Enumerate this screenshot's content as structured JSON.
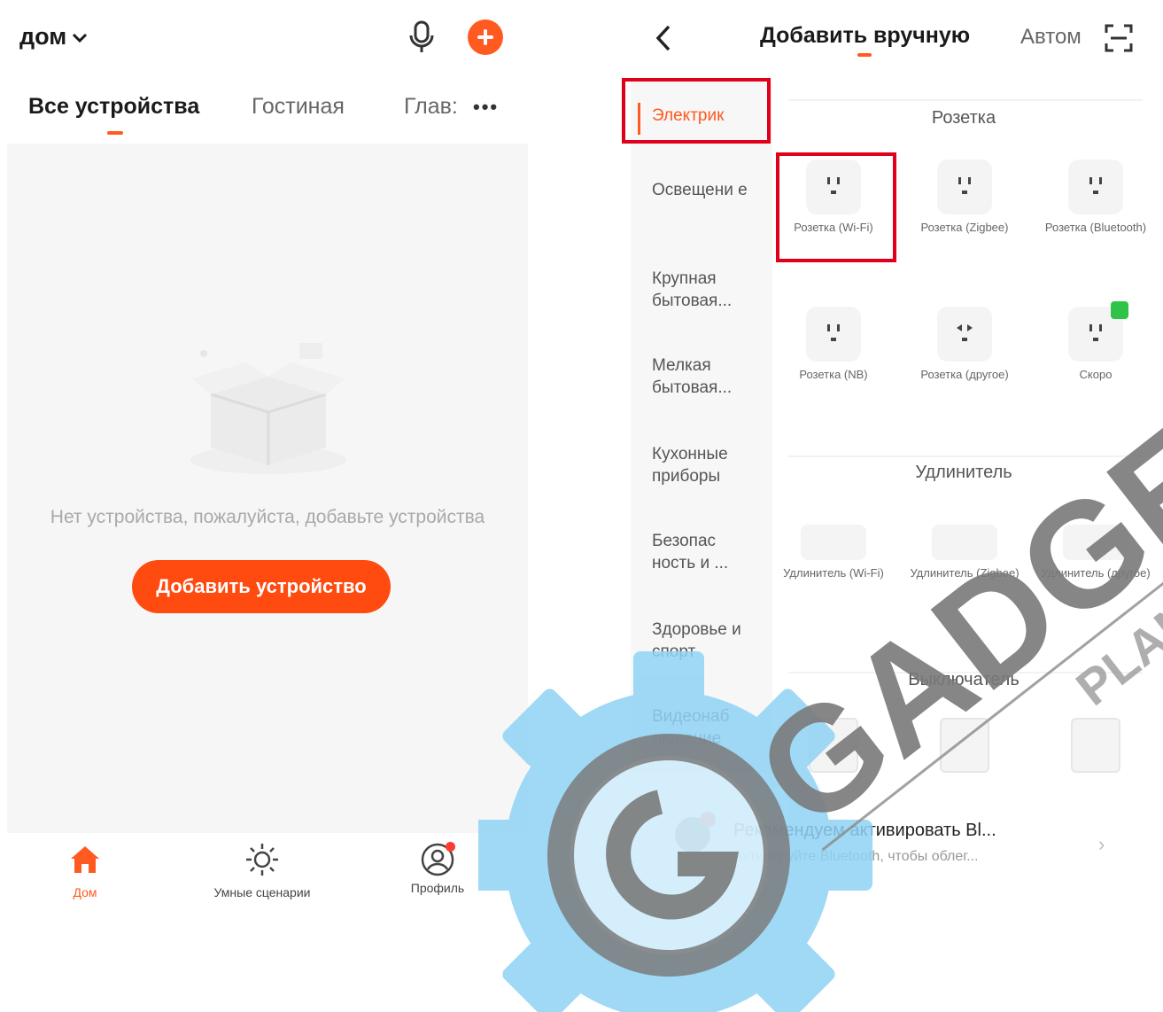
{
  "left": {
    "home": {
      "title": "дом"
    },
    "tabs": [
      {
        "label": "Все устройства"
      },
      {
        "label": "Гостиная"
      },
      {
        "label": "Глав:"
      }
    ],
    "more_dots": "•••",
    "empty": {
      "text": "Нет устройства, пожалуйста, добавьте устройства",
      "button": "Добавить устройство"
    },
    "nav": [
      {
        "label": "Дом"
      },
      {
        "label": "Умные сценарии"
      },
      {
        "label": "Профиль"
      }
    ]
  },
  "right": {
    "title": "Добавить вручную",
    "auto_tab": "Автом",
    "categories": [
      {
        "label": "Электрик"
      },
      {
        "label": "Освещени е"
      },
      {
        "label": "Крупная бытовая..."
      },
      {
        "label": "Мелкая бытовая..."
      },
      {
        "label": "Кухонные приборы"
      },
      {
        "label": "Безопас ность и ..."
      },
      {
        "label": "Здоровье и спорт"
      },
      {
        "label": "Видеонаб людение"
      }
    ],
    "sections": [
      {
        "title": "Розетка",
        "devices": [
          {
            "name": "Розетка (Wi-Fi)"
          },
          {
            "name": "Розетка (Zigbee)"
          },
          {
            "name": "Розетка (Bluetooth)"
          },
          {
            "name": "Розетка (NB)"
          },
          {
            "name": "Розетка (другое)"
          },
          {
            "name": "Скоро"
          }
        ]
      },
      {
        "title": "Удлинитель",
        "devices": [
          {
            "name": "Удлинитель (Wi-Fi)"
          },
          {
            "name": "Удлинитель (Zigbee)"
          },
          {
            "name": "Удлинитель (другое)"
          }
        ]
      },
      {
        "title": "Выключатель"
      }
    ],
    "notice": {
      "title": "Рекомендуем активировать Bl...",
      "subtitle": "Активируйте Bluetooth, чтобы облег..."
    }
  },
  "watermark": {
    "brand": "GADGET",
    "sub": "PLAN"
  },
  "colors": {
    "accent": "#ff5a1f",
    "highlight": "#e0001b",
    "soon": "#2fc447"
  }
}
